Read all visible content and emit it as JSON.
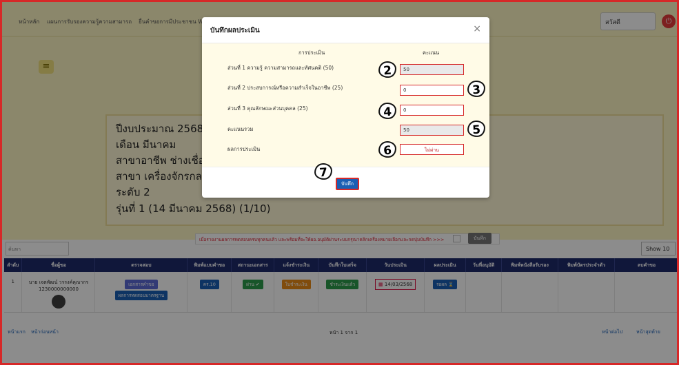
{
  "topnav": {
    "links": [
      "หน้าหลัก",
      "แผนการรับรองความรู้ความสามารถ",
      "ยื่นคำขอการมีประชาชน Walk"
    ],
    "user": "สวัสดี",
    "logout_icon": "logout-icon"
  },
  "background": {
    "info_lines": [
      "ปีงบประมาณ 2568",
      "เดือน มีนาคม",
      "สาขาอาชีพ ช่างเชื่อมอ",
      "สาขา เครื่องจักรกลแล",
      "ระดับ 2",
      "รุ่นที่ 1 (14 มีนาคม 2568) (1/10)"
    ],
    "notice_text": "เมื่อรายงานผลการทดสอบครบทุกคนแล้ว และพร้อมที่จะให้ผอ.อนุมัติผ่านระบบกรุณาคลิกเครื่องหมายเลือกและกดปุ่มบันทึก >>>",
    "notice_button": "บันทึก",
    "search_placeholder": "ค้นหา",
    "show_label": "Show 10"
  },
  "table": {
    "headers": [
      "ลำดับ",
      "ชื่อผู้ขอ",
      "ตรวจสอบ",
      "พิมพ์แบบคำขอ",
      "สถานะเอกสาร",
      "แจ้งชำระเงิน",
      "บันทึกใบเสร็จ",
      "วันประเมิน",
      "ผลประเมิน",
      "วันที่อนุมัติ",
      "พิมพ์หนังสือรับรอง",
      "พิมพ์บัตรประจำตัว",
      "ลบคำขอ"
    ],
    "row": {
      "no": "1",
      "name": "นาย เจตพัฒน์ วรรงค์คุณากร",
      "id": "1230000000000",
      "check_tags": [
        "เอกสารคำขอ",
        "ผลการทดสอบมาตรฐาน"
      ],
      "form": "คร.10",
      "doc_status": "ผ่าน",
      "payment_notify": "ใบชำระเงิน",
      "receipt": "ชำระเงินแล้ว",
      "eval_date": "14/03/2568",
      "result": "รอผล"
    }
  },
  "pager": {
    "first": "หน้าแรก",
    "prev": "หน้าก่อนหน้า",
    "info": "หน้า 1 จาก 1",
    "next": "หน้าต่อไป",
    "last": "หน้าสุดท้าย"
  },
  "modal": {
    "title": "บันทึกผลประเมิน",
    "close": "×",
    "col_eval": "การประเมิน",
    "col_score": "คะแนน",
    "rows": [
      {
        "label": "ส่วนที่ 1 ความรู้ ความสามารถและทัศนคติ (50)",
        "value": "50"
      },
      {
        "label": "ส่วนที่ 2 ประสบการณ์หรือความสำเร็จในอาชีพ (25)",
        "value": "0"
      },
      {
        "label": "ส่วนที่ 3 คุณลักษณะส่วนบุคคล (25)",
        "value": "0"
      },
      {
        "label": "คะแนนรวม",
        "value": "50"
      },
      {
        "label": "ผลการประเมิน",
        "value": "ไม่ผ่าน"
      }
    ],
    "save": "บันทึก"
  },
  "annotations": [
    "2",
    "3",
    "4",
    "5",
    "6",
    "7"
  ],
  "colors": {
    "accent_red": "#d62828",
    "nav_yellow": "#fdf6c3",
    "header_navy": "#1e2a6b",
    "button_blue": "#1a5fb4"
  }
}
